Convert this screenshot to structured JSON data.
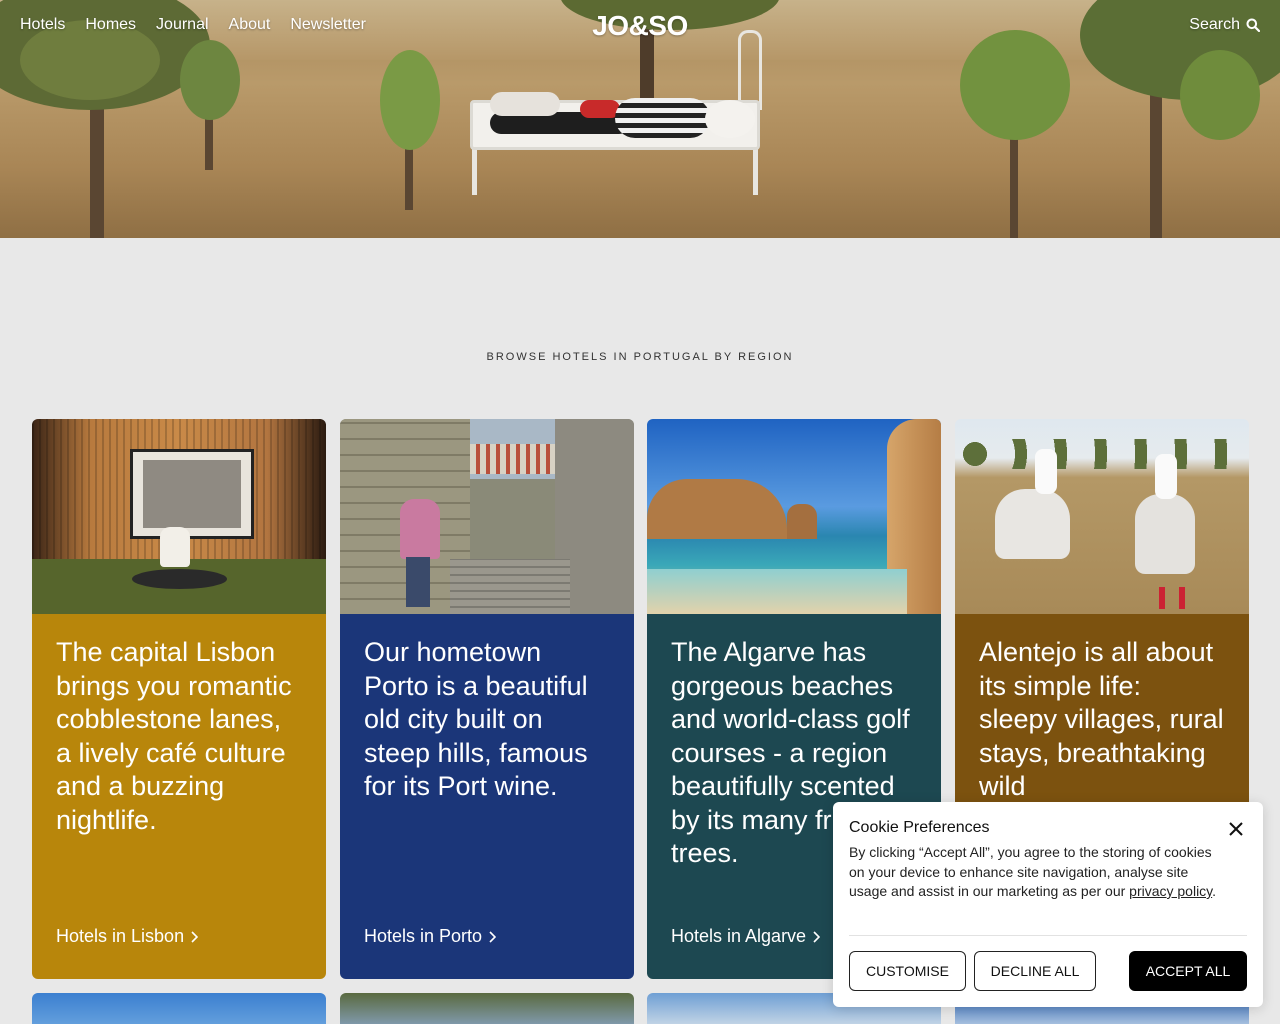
{
  "nav": {
    "links": [
      "Hotels",
      "Homes",
      "Journal",
      "About",
      "Newsletter"
    ],
    "logo": "JO&SO",
    "search_label": "Search"
  },
  "section": {
    "title": "BROWSE HOTELS IN PORTUGAL BY REGION"
  },
  "cards": [
    {
      "description": "The capital Lisbon brings you romantic cobblestone lanes, a lively café culture and a buzzing nightlife.",
      "link": "Hotels in Lisbon",
      "color": "#b8860b"
    },
    {
      "description": "Our hometown Porto is a beautiful old city built on steep hills, famous for its Port wine.",
      "link": "Hotels in Porto",
      "color": "#1b3679"
    },
    {
      "description": "The Algarve has gorgeous beaches and world-class golf courses - a region beautifully scented by its many fruit trees.",
      "link": "Hotels in Algarve",
      "color": "#1d4851"
    },
    {
      "description": "Alentejo is all about its simple life: sleepy villages, rural stays, breathtaking wild",
      "link": "",
      "color": "#7c520f"
    }
  ],
  "cookie": {
    "title": "Cookie Preferences",
    "text": "By clicking “Accept All”, you agree to the storing of cookies on your device to enhance site navigation, analyse site usage and assist in our marketing as per our",
    "policy_link": "privacy policy",
    "policy_suffix": ".",
    "buttons": {
      "customise": "CUSTOMISE",
      "decline": "DECLINE ALL",
      "accept": "ACCEPT ALL"
    }
  },
  "icons": {
    "search": "search-icon",
    "close": "close-icon",
    "chevron": "chevron-right-icon"
  }
}
